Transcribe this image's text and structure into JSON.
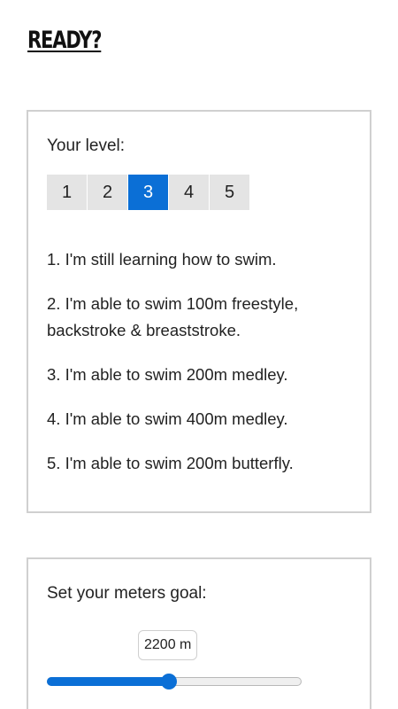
{
  "header": {
    "title": "READY?"
  },
  "level_card": {
    "label": "Your level:",
    "options": [
      "1",
      "2",
      "3",
      "4",
      "5"
    ],
    "selected_index": 2,
    "descriptions": [
      "1. I'm still learning how to swim.",
      "2. I'm able to swim 100m freestyle, backstroke & breaststroke.",
      "3. I'm able to swim 200m medley.",
      "4. I'm able to swim 400m medley.",
      "5. I'm able to swim 200m butterfly."
    ]
  },
  "goal_card": {
    "label": "Set your meters goal:",
    "value_display": "2200 m",
    "slider_fraction": 0.48
  },
  "colors": {
    "accent": "#0b6fd6",
    "inactive_button": "#e4e4e4",
    "card_border": "#d0d0d0"
  }
}
